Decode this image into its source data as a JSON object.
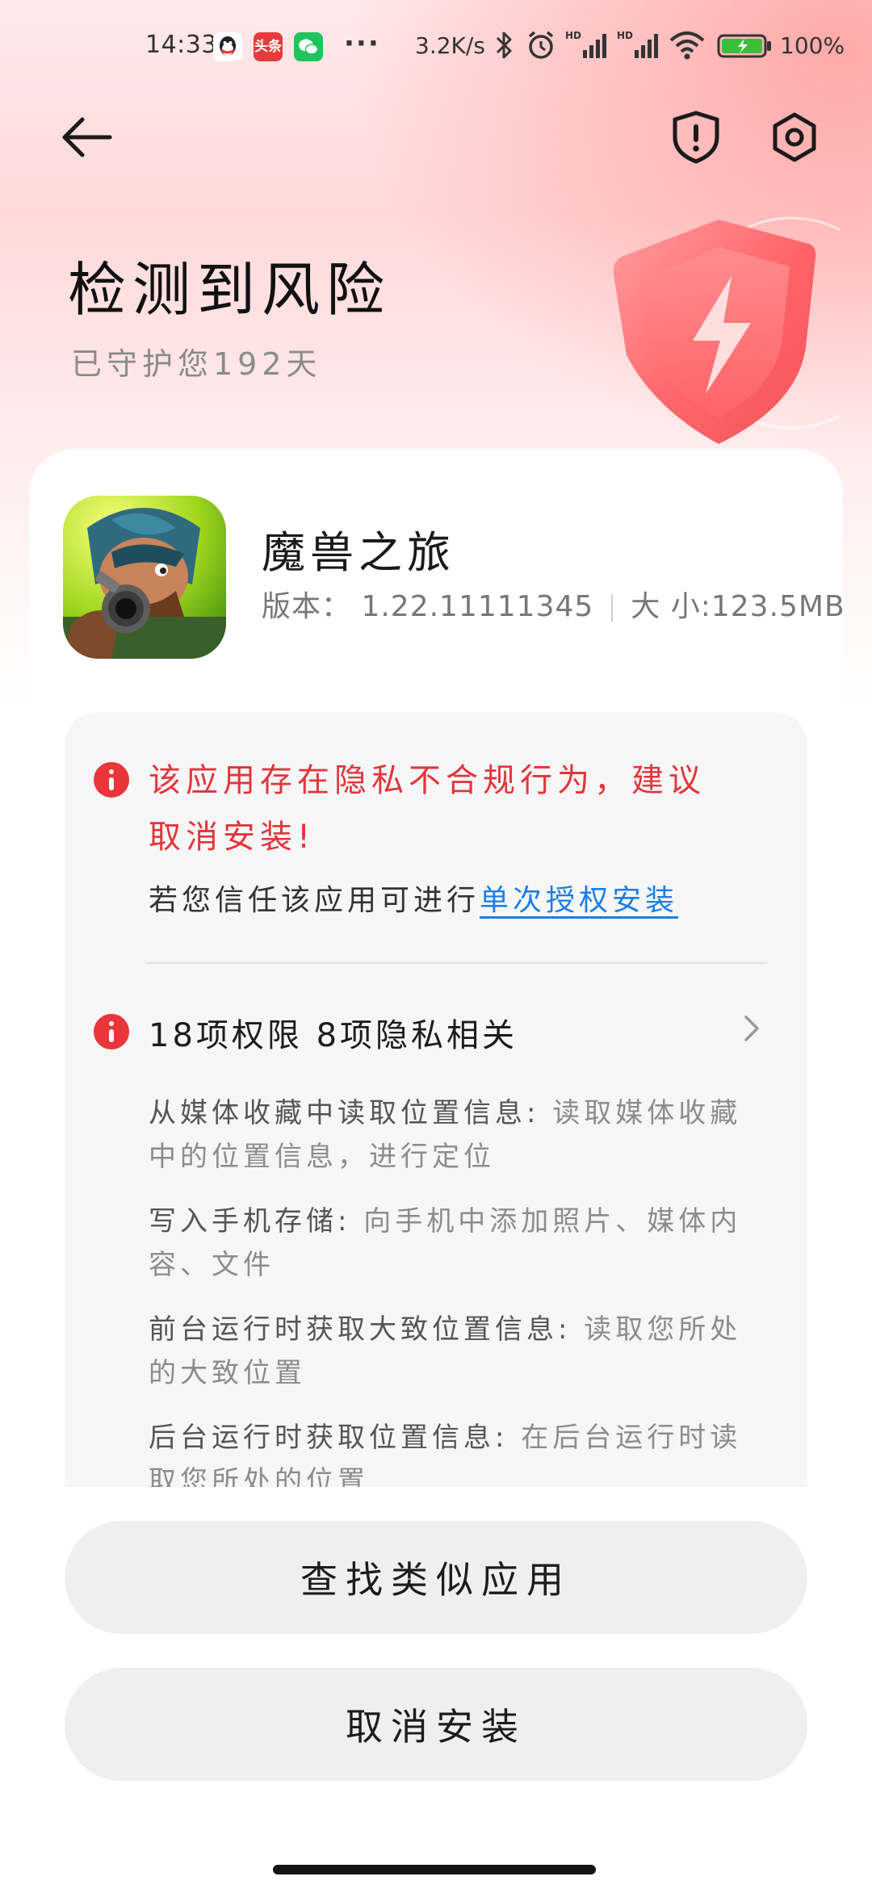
{
  "status_bar": {
    "time": "14:33",
    "more": "···",
    "network_speed": "3.2K/s",
    "battery": "100%",
    "notification_icons": [
      "qq-icon",
      "toutiao-icon",
      "wechat-icon"
    ],
    "toutiao_label": "头条",
    "signal_label": "HD"
  },
  "header": {
    "title": "检测到风险",
    "subtitle": "已守护您192天"
  },
  "app": {
    "name": "魔兽之旅",
    "version_text": "版本： 1.22.11111345",
    "size_text": "大 小:123.5MB"
  },
  "risk": {
    "warning": "该应用存在隐私不合规行为，建议取消安装!",
    "trust_prefix": "若您信任该应用可进行",
    "trust_link": "单次授权安装",
    "permissions_summary": "18项权限  8项隐私相关",
    "permissions": [
      {
        "name": "从媒体收藏中读取位置信息:",
        "desc": " 读取媒体收藏中的位置信息，进行定位"
      },
      {
        "name": "写入手机存储:",
        "desc": " 向手机中添加照片、媒体内容、文件"
      },
      {
        "name": "前台运行时获取大致位置信息:",
        "desc": " 读取您所处的大致位置"
      },
      {
        "name": "后台运行时获取位置信息:",
        "desc": " 在后台运行时读取您所处的位置"
      }
    ]
  },
  "buttons": {
    "find_similar": "查找类似应用",
    "cancel_install": "取消安装"
  },
  "colors": {
    "danger": "#e2363b",
    "link": "#1a7fe6",
    "button_bg": "#efefef"
  }
}
